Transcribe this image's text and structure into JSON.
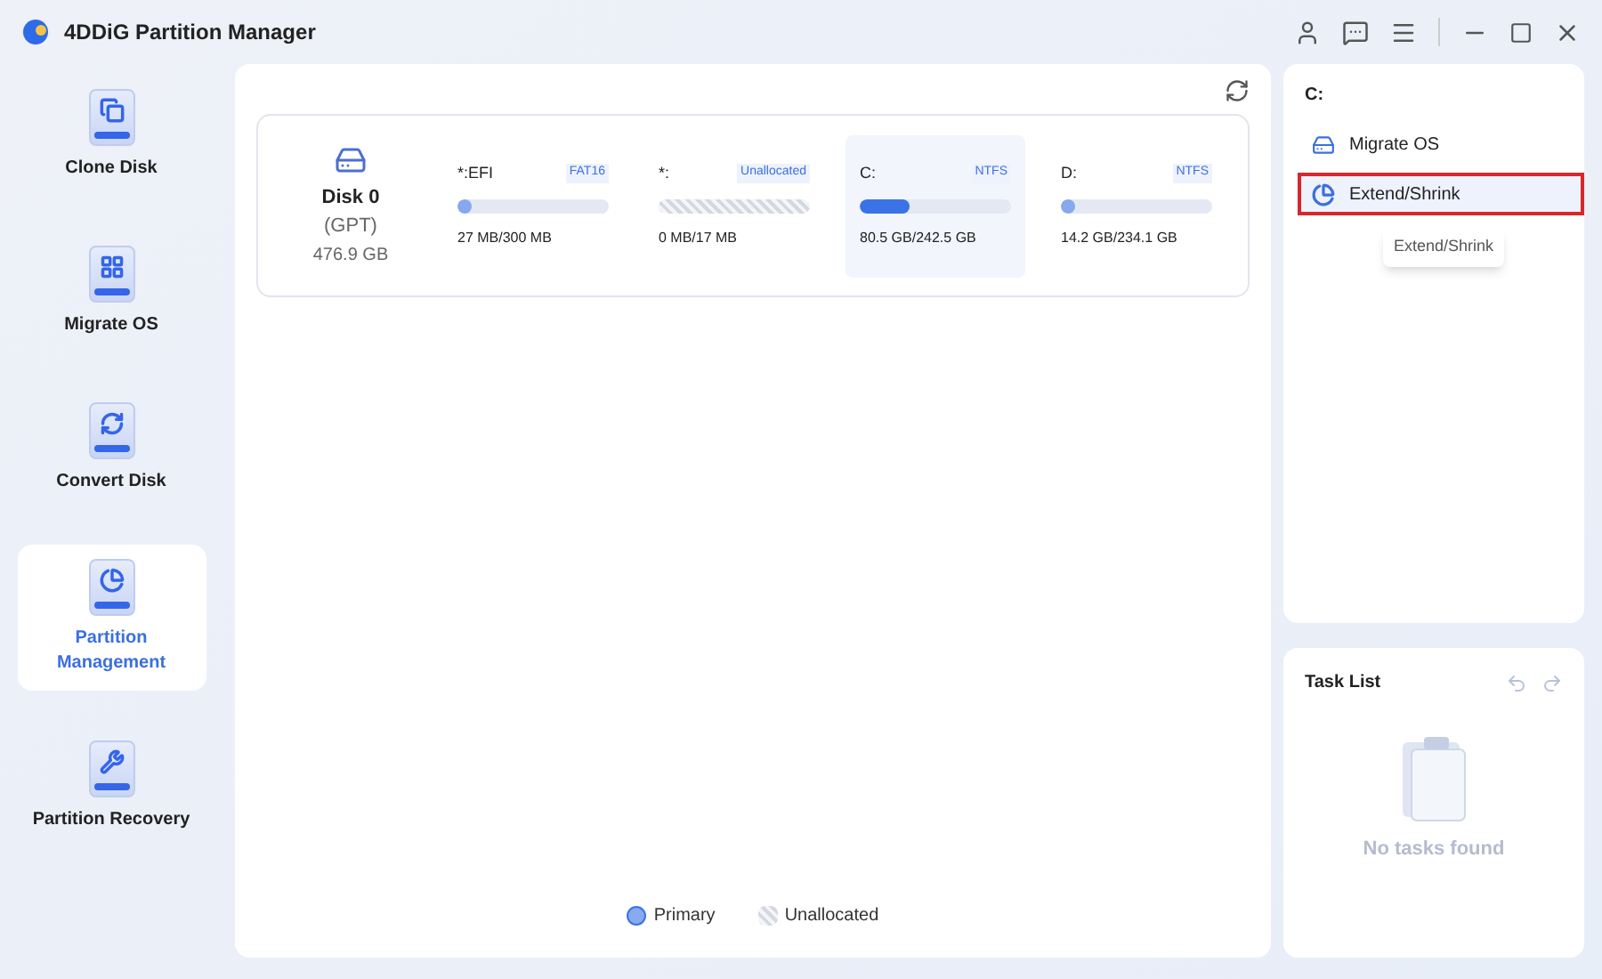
{
  "window": {
    "title": "4DDiG Partition Manager"
  },
  "sidebar": {
    "items": [
      {
        "label": "Clone Disk",
        "selected": false
      },
      {
        "label": "Migrate OS",
        "selected": false
      },
      {
        "label": "Convert Disk",
        "selected": false
      },
      {
        "label": "Partition Management",
        "selected": true
      },
      {
        "label": "Partition Recovery",
        "selected": false
      }
    ]
  },
  "disk": {
    "name": "Disk 0",
    "style": "(GPT)",
    "size": "476.9 GB",
    "partitions": [
      {
        "name": "*:EFI",
        "fs": "FAT16",
        "usage": "27 MB/300 MB",
        "kind": "primary",
        "level": 0.03,
        "selected": false
      },
      {
        "name": "*:",
        "fs": "Unallocated",
        "usage": "0 MB/17 MB",
        "kind": "unallocated",
        "selected": false
      },
      {
        "name": "C:",
        "fs": "NTFS",
        "usage": "80.5 GB/242.5 GB",
        "kind": "primary",
        "level": 0.33,
        "selected": true
      },
      {
        "name": "D:",
        "fs": "NTFS",
        "usage": "14.2 GB/234.1 GB",
        "kind": "primary",
        "level": 0.06,
        "selected": false
      }
    ]
  },
  "legend": [
    {
      "label": "Primary",
      "kind": "primary"
    },
    {
      "label": "Unallocated",
      "kind": "unallocated"
    }
  ],
  "actions": {
    "title": "C:",
    "items": [
      {
        "label": "Migrate OS",
        "selected": false
      },
      {
        "label": "Extend/Shrink",
        "selected": true
      }
    ],
    "tooltip": "Extend/Shrink"
  },
  "task_list": {
    "title": "Task List",
    "empty": "No tasks found"
  }
}
